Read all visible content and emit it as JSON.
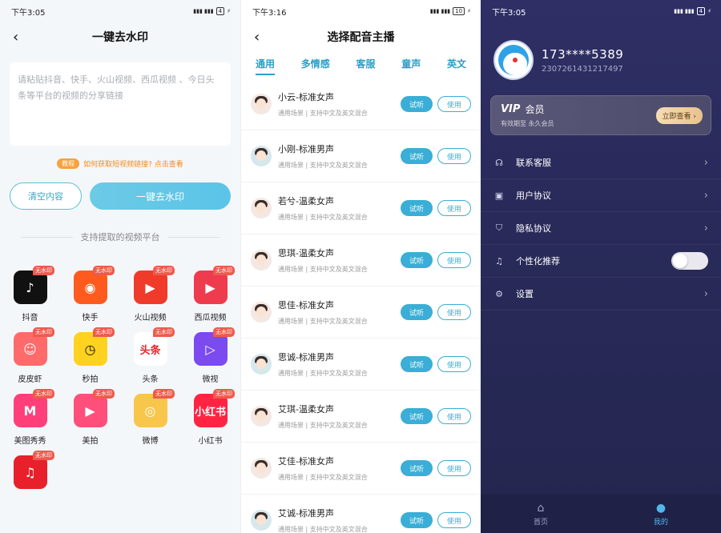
{
  "panel1": {
    "status_time": "下午3:05",
    "battery": "4",
    "title": "一键去水印",
    "input_placeholder": "请粘贴抖音、快手、火山视频、西瓜视频 、今日头条等平台的视频的分享链接",
    "tutorial_tag": "教程",
    "tutorial_link": "如何获取短视频链接? 点击查看",
    "clear_button": "清空内容",
    "main_button": "一键去水印",
    "platforms_title": "支持提取的视频平台",
    "badge_text": "无水印",
    "apps": [
      {
        "label": "抖音",
        "glyph": "♪",
        "color": "#111111"
      },
      {
        "label": "快手",
        "glyph": "◉",
        "color": "#ff5b1f"
      },
      {
        "label": "火山视频",
        "glyph": "▶",
        "color": "#f03b2a"
      },
      {
        "label": "西瓜视频",
        "glyph": "▶",
        "color": "#ef3b4e"
      },
      {
        "label": "皮皮虾",
        "glyph": "☺",
        "color": "#ff6a6a"
      },
      {
        "label": "秒拍",
        "glyph": "◷",
        "color": "#ffd21f"
      },
      {
        "label": "头条",
        "glyph": "头条",
        "color": "#ffffff"
      },
      {
        "label": "微视",
        "glyph": "▷",
        "color": "#7b4bf0"
      },
      {
        "label": "美图秀秀",
        "glyph": "M",
        "color": "#ff3f79"
      },
      {
        "label": "美拍",
        "glyph": "▶",
        "color": "#ff4f7a"
      },
      {
        "label": "微博",
        "glyph": "◎",
        "color": "#f7c64a"
      },
      {
        "label": "小红书",
        "glyph": "小红书",
        "color": "#ff2442"
      },
      {
        "label": "",
        "glyph": "♫",
        "color": "#e8202b"
      }
    ]
  },
  "panel2": {
    "status_time": "下午3:16",
    "battery": "10",
    "title": "选择配音主播",
    "tabs": [
      "通用",
      "多情感",
      "客服",
      "童声",
      "英文"
    ],
    "try_label": "试听",
    "use_label": "使用",
    "voices": [
      {
        "name": "小云-标准女声",
        "desc": "通用场景 | 支持中文及英文混合",
        "gender": "f"
      },
      {
        "name": "小刚-标准男声",
        "desc": "通用场景 | 支持中文及英文混合",
        "gender": "m"
      },
      {
        "name": "若兮-温柔女声",
        "desc": "通用场景 | 支持中文及英文混合",
        "gender": "f"
      },
      {
        "name": "思琪-温柔女声",
        "desc": "通用场景 | 支持中文及英文混合",
        "gender": "f"
      },
      {
        "name": "思佳-标准女声",
        "desc": "通用场景 | 支持中文及英文混合",
        "gender": "f"
      },
      {
        "name": "思诚-标准男声",
        "desc": "通用场景 | 支持中文及英文混合",
        "gender": "m"
      },
      {
        "name": "艾琪-温柔女声",
        "desc": "通用场景 | 支持中文及英文混合",
        "gender": "f"
      },
      {
        "name": "艾佳-标准女声",
        "desc": "通用场景 | 支持中文及英文混合",
        "gender": "f"
      },
      {
        "name": "艾诚-标准男声",
        "desc": "通用场景 | 支持中文及英文混合",
        "gender": "m"
      }
    ]
  },
  "panel3": {
    "status_time": "下午3:05",
    "battery": "4",
    "phone": "173****5389",
    "user_id": "2307261431217497",
    "vip_logo": "VIP",
    "vip_title": "会员",
    "vip_validity": "有效期至 永久会员",
    "vip_button": "立即查看 ›",
    "menu": [
      {
        "label": "联系客服",
        "icon": "☊",
        "type": "link"
      },
      {
        "label": "用户协议",
        "icon": "▣",
        "type": "link"
      },
      {
        "label": "隐私协议",
        "icon": "⛉",
        "type": "link"
      },
      {
        "label": "个性化推荐",
        "icon": "♫",
        "type": "toggle"
      },
      {
        "label": "设置",
        "icon": "⚙",
        "type": "link"
      }
    ],
    "personalized_recommend_on": false,
    "nav": [
      {
        "label": "首页",
        "icon": "⌂",
        "active": false
      },
      {
        "label": "我的",
        "icon": "●",
        "active": true
      }
    ]
  }
}
